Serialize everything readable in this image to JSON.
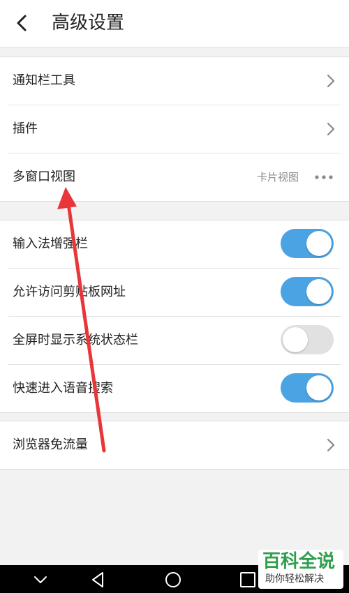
{
  "header": {
    "title": "高级设置"
  },
  "section1": {
    "items": [
      {
        "label": "通知栏工具"
      },
      {
        "label": "插件"
      },
      {
        "label": "多窗口视图",
        "value": "卡片视图"
      }
    ]
  },
  "section2": {
    "items": [
      {
        "label": "输入法增强栏",
        "enabled": true
      },
      {
        "label": "允许访问剪贴板网址",
        "enabled": true
      },
      {
        "label": "全屏时显示系统状态栏",
        "enabled": false
      },
      {
        "label": "快速进入语音搜索",
        "enabled": true
      }
    ]
  },
  "section3": {
    "items": [
      {
        "label": "浏览器免流量"
      }
    ]
  },
  "watermark": {
    "main": "百科全说",
    "sub": "助你轻松解决"
  },
  "colors": {
    "toggle_on": "#4aa3e2",
    "toggle_off": "#e1e1e1",
    "annotation_arrow": "#e8363a",
    "watermark_green": "#2f9e4d"
  }
}
